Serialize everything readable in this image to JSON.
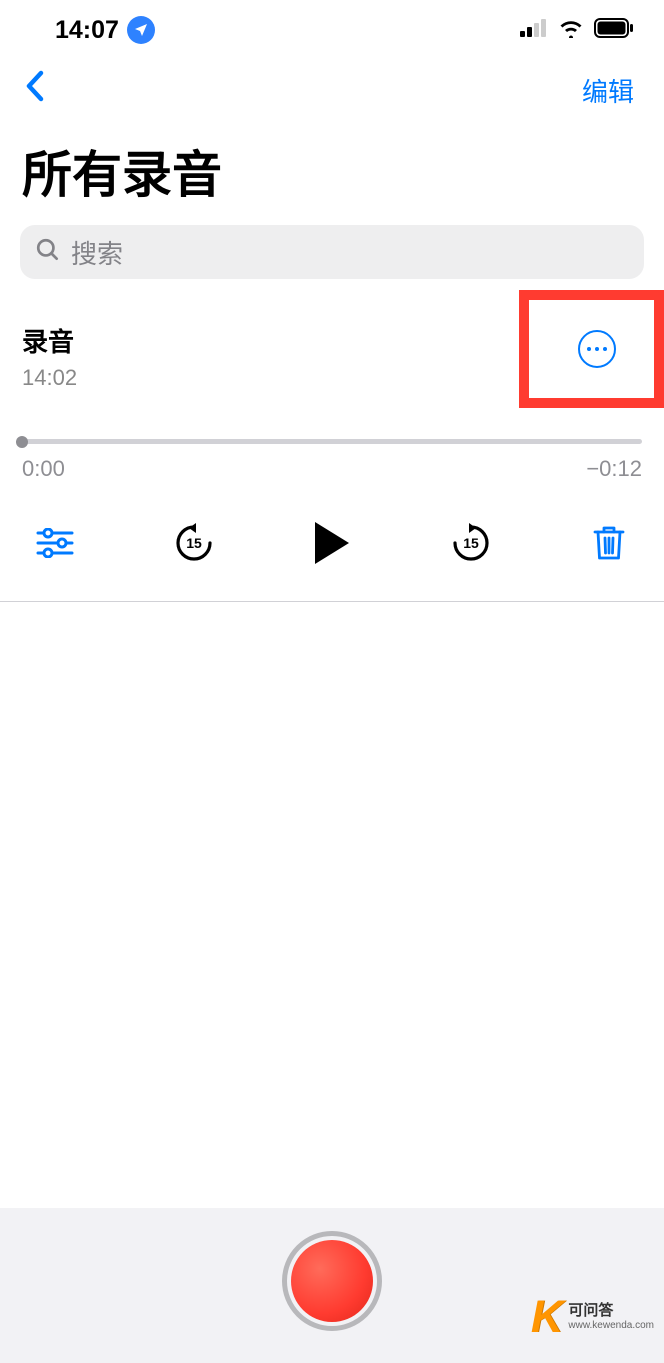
{
  "status": {
    "time": "14:07"
  },
  "nav": {
    "edit_label": "编辑"
  },
  "header": {
    "title": "所有录音"
  },
  "search": {
    "placeholder": "搜索"
  },
  "recording": {
    "title": "录音",
    "timestamp": "14:02",
    "elapsed": "0:00",
    "remaining": "−0:12",
    "skip_seconds": "15"
  },
  "watermark": {
    "letter": "K",
    "name": "可问答",
    "url": "www.kewenda.com"
  }
}
